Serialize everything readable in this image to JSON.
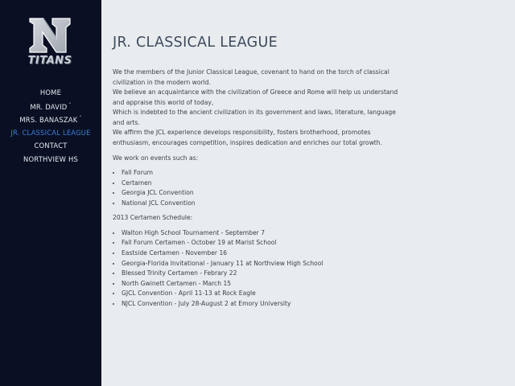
{
  "logo": {
    "letter": "N",
    "word": "TITANS"
  },
  "nav": [
    {
      "label": "HOME",
      "caret": ""
    },
    {
      "label": "MR. DAVID",
      "caret": "ˇ"
    },
    {
      "label": "MRS. BANASZAK",
      "caret": "ˇ"
    },
    {
      "label": "JR. CLASSICAL LEAGUE",
      "caret": ""
    },
    {
      "label": "CONTACT",
      "caret": ""
    },
    {
      "label": "NORTHVIEW HS",
      "caret": ""
    }
  ],
  "colors": {
    "sidebar": "#0a0f24",
    "active_link": "#3c7fd6",
    "background": "#e9ecef"
  },
  "page": {
    "title": "JR. CLASSICAL LEAGUE",
    "intro": [
      "We the members of the Junior Classical League, covenant to hand on the torch of classical civilization in the modern world.",
      "We believe an acquaintance with the civilization of Greece and Rome will help us understand and appraise this world of today,",
      "Which is indebted to the ancient civilization in its government and laws, literature, language and arts.",
      "We affirm the JCL experience develops responsibility, fosters brotherhood, promotes enthusiasm, encourages competition, inspires dedication and enriches our total growth."
    ],
    "events_heading": "We work on events such as:",
    "events": [
      "Fall Forum",
      "Certamen",
      "Georgia JCL Convention",
      "National JCL Convention"
    ],
    "schedule_heading": "2013 Certamen Schedule:",
    "schedule": [
      "Walton High School Tournament - September 7",
      "Fall Forum Certamen - October 19 at Marist School",
      "Eastside Certamen - November 16",
      "Georgia-Florida Invitational - January 11 at Northview High School",
      "Blessed Trinity Certamen - Febrary 22",
      "North Gwinett Certamen - March 15",
      "GJCL Convention - April 11-13 at Rock Eagle",
      "NJCL Convention - July 28-August 2 at Emory University"
    ]
  }
}
